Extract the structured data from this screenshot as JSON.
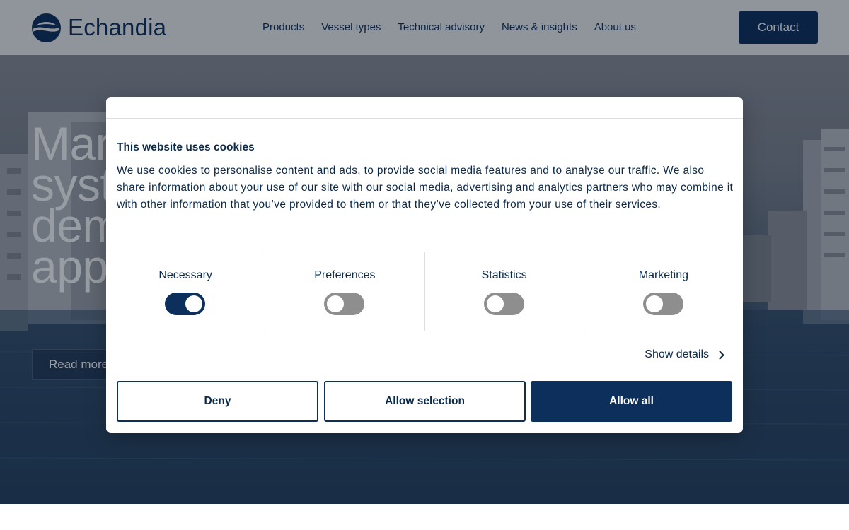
{
  "brand": {
    "name": "Echandia",
    "logo_icon": "echandia-logo-icon",
    "color_primary": "#0c2f5c"
  },
  "nav": {
    "items": [
      {
        "label": "Products"
      },
      {
        "label": "Vessel types"
      },
      {
        "label": "Technical advisory"
      },
      {
        "label": "News & insights"
      },
      {
        "label": "About us"
      }
    ],
    "contact_label": "Contact"
  },
  "hero": {
    "title_lines": [
      "Mar",
      "syst",
      "dem",
      "app"
    ],
    "read_more_label": "Read more"
  },
  "cookie_dialog": {
    "title": "This website uses cookies",
    "body": "We use cookies to personalise content and ads, to provide social media features and to analyse our traffic. We also share information about your use of our site with our social media, advertising and analytics partners who may combine it with other information that you’ve provided to them or that they’ve collected from your use of their services.",
    "categories": [
      {
        "label": "Necessary",
        "enabled": true
      },
      {
        "label": "Preferences",
        "enabled": false
      },
      {
        "label": "Statistics",
        "enabled": false
      },
      {
        "label": "Marketing",
        "enabled": false
      }
    ],
    "show_details_label": "Show details",
    "buttons": {
      "deny": "Deny",
      "allow_selection": "Allow selection",
      "allow_all": "Allow all"
    }
  }
}
